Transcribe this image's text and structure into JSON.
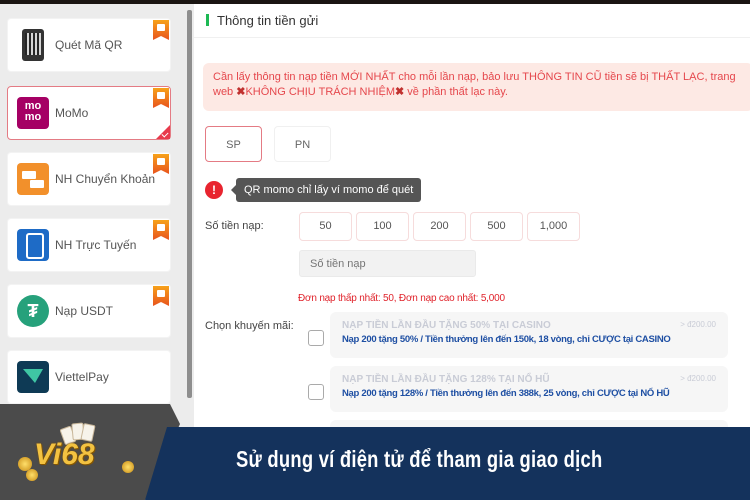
{
  "sidebar": {
    "items": [
      {
        "label": "Quét Mã QR",
        "icon": "qr-phone-icon",
        "recommended": true,
        "active": false
      },
      {
        "label": "MoMo",
        "icon": "momo-logo",
        "logo_text": "mo mo",
        "recommended": true,
        "active": true
      },
      {
        "label": "NH Chuyển Khoản",
        "icon": "bank-transfer-icon",
        "recommended": true,
        "active": false
      },
      {
        "label": "NH Trực Tuyến",
        "icon": "online-banking-icon",
        "recommended": true,
        "active": false
      },
      {
        "label": "Nạp USDT",
        "icon": "tether-icon",
        "logo_text": "₮",
        "recommended": true,
        "active": false
      },
      {
        "label": "ViettelPay",
        "icon": "viettelpay-icon",
        "recommended": false,
        "active": false
      }
    ]
  },
  "main": {
    "title": "Thông tin tiền gửi",
    "notice": {
      "part1": "Cần lấy thông tin nạp tiền MỚI NHẤT cho mỗi lần nạp, bảo lưu THÔNG TIN CŨ tiền sẽ bị THẤT LẠC, trang web ",
      "x1": "✖",
      "part2": "KHÔNG CHỊU TRÁCH NHIỆM",
      "x2": "✖",
      "part3": " về phần thất lạc này."
    },
    "tabs": [
      {
        "label": "SP",
        "selected": true
      },
      {
        "label": "PN",
        "selected": false
      }
    ],
    "alert_icon": "!",
    "tooltip": "QR momo chỉ lấy ví momo để quét",
    "amount_label": "Số tiền nạp:",
    "amount_options": [
      "50",
      "100",
      "200",
      "500",
      "1,000"
    ],
    "amount_input": {
      "value": "",
      "placeholder": "Số tiền nạp"
    },
    "limits": "Đơn nạp thấp nhất:  50,  Đơn nạp cao nhất:  5,000",
    "promo_label": "Chọn khuyến mãi:",
    "promotions": [
      {
        "title": "NẠP TIỀN LẦN ĐẦU TẶNG 50% TẠI CASINO",
        "desc": "Nạp 200 tặng 50% / Tiền thưởng lên đến 150k, 18 vòng, chỉ CƯỢC tại CASINO",
        "min": "> đ200.00",
        "checked": false
      },
      {
        "title": "NẠP TIỀN LẦN ĐẦU TẶNG 128% TẠI NỔ HŨ",
        "desc": "Nạp 200 tặng 128% / Tiền thưởng lên đến 388k, 25 vòng, chỉ CƯỢC tại NỔ HŨ",
        "min": "> đ200.00",
        "checked": false
      }
    ]
  },
  "banner": {
    "brand": "Vi68",
    "caption": "Sử dụng ví điện tử để tham gia giao dịch"
  },
  "colors": {
    "accent_red": "#e47b84",
    "notice_text": "#e5474c",
    "banner_navy": "#14325c",
    "title_marker": "#1db954"
  }
}
